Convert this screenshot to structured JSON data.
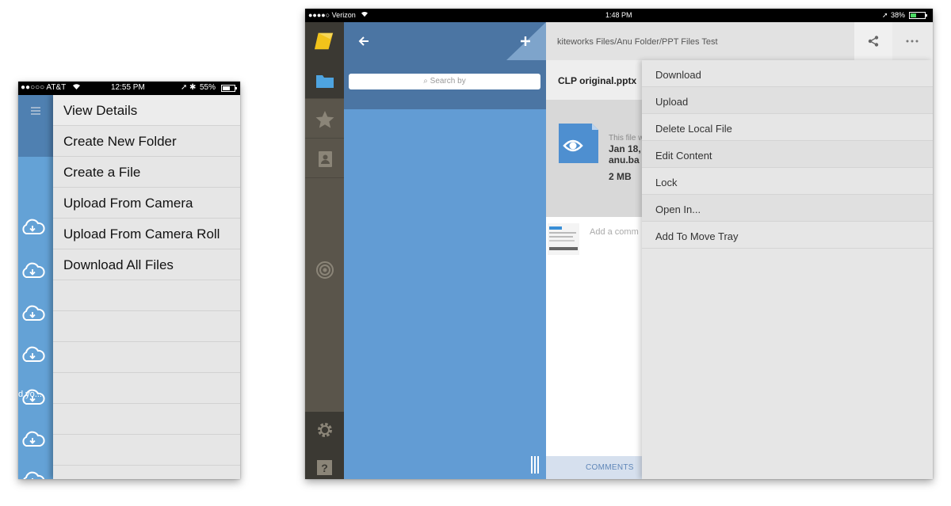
{
  "phone": {
    "status": {
      "carrier": "●●○○○ AT&T",
      "time": "12:55 PM",
      "battery": "55%"
    },
    "menu_items": [
      {
        "label": "View Details"
      },
      {
        "label": "Create New Folder"
      },
      {
        "label": "Create a File"
      },
      {
        "label": "Upload From Camera"
      },
      {
        "label": "Upload From Camera Roll"
      },
      {
        "label": "Download All Files"
      }
    ],
    "truncated_text": "d yo..."
  },
  "tablet": {
    "status": {
      "carrier": "●●●●○ Verizon",
      "time": "1:48 PM",
      "battery": "38%"
    },
    "search": {
      "placeholder": "Search by"
    },
    "breadcrumb": "kiteworks Files/Anu Folder/PPT Files Test",
    "file": {
      "name": "CLP original.pptx",
      "info_line1": "This file w",
      "info_line2": "Jan 18,",
      "info_line3": "anu.ba",
      "size": "2 MB"
    },
    "comment_placeholder": "Add a comm",
    "comments_tab": "COMMENTS",
    "actions": [
      {
        "label": "Download"
      },
      {
        "label": "Upload"
      },
      {
        "label": "Delete Local File"
      },
      {
        "label": "Edit Content"
      },
      {
        "label": "Lock"
      },
      {
        "label": "Open In..."
      },
      {
        "label": "Add To Move Tray"
      }
    ]
  },
  "colors": {
    "blue_list": "#629cd4",
    "blue_header": "#4b75a3",
    "rail_dark": "#3b3933",
    "rail": "#5a554b",
    "logo_yellow": "#f2c31b",
    "menu_bg": "#e6e6e6"
  }
}
